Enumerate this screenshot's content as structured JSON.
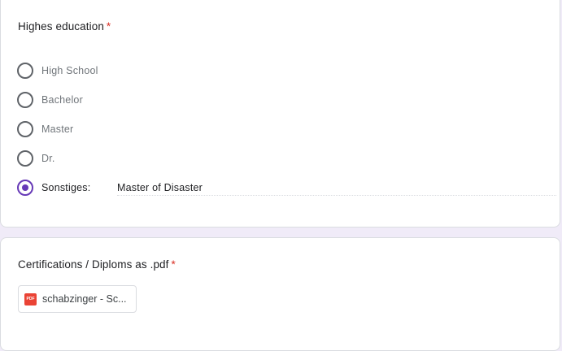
{
  "education": {
    "title": "Highes education",
    "required_marker": "*",
    "options": [
      {
        "label": "High School",
        "selected": false
      },
      {
        "label": "Bachelor",
        "selected": false
      },
      {
        "label": "Master",
        "selected": false
      },
      {
        "label": "Dr.",
        "selected": false
      },
      {
        "label": "Sonstiges:",
        "selected": true
      }
    ],
    "other_value": "Master of Disaster"
  },
  "certifications": {
    "title": "Certifications / Diploms as .pdf",
    "required_marker": "*",
    "file": {
      "icon": "pdf-file-icon",
      "icon_text": "PDF",
      "name": "schabzinger - Sc..."
    }
  },
  "colors": {
    "accent": "#673ab7",
    "required": "#d93025",
    "background": "#f0ebf8",
    "pdf": "#ea4335"
  }
}
